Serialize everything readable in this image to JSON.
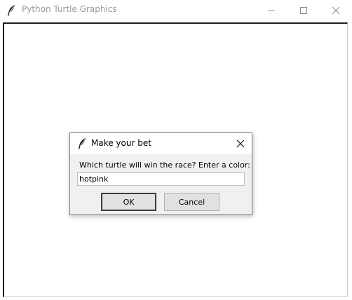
{
  "window": {
    "title": "Python Turtle Graphics",
    "icon": "feather-icon",
    "controls": [
      "minimize-icon",
      "maximize-icon",
      "close-icon"
    ]
  },
  "dialog": {
    "title": "Make your bet",
    "icon": "feather-icon",
    "prompt": "Which turtle will win the race? Enter a color:",
    "input_value": "hotpink",
    "ok_label": "OK",
    "cancel_label": "Cancel"
  },
  "colors": {
    "canvas_background": "#ffffff",
    "dialog_background": "#f0f0f0",
    "button_background": "#e1e1e1"
  }
}
